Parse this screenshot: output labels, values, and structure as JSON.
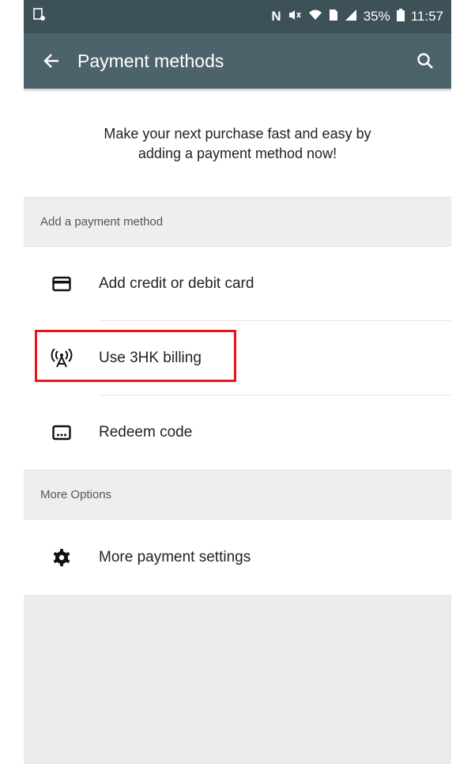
{
  "status_bar": {
    "notification_icon": "screenshot-icon",
    "nfc_label": "N",
    "battery_percent": "35%",
    "time": "11:57"
  },
  "app_bar": {
    "title": "Payment methods",
    "back_icon": "arrow-back-icon",
    "search_icon": "search-icon",
    "color": "#4d636b"
  },
  "intro": {
    "line1": "Make your next purchase fast and easy by",
    "line2": "adding a payment method now!"
  },
  "add_section": {
    "header": "Add a payment method",
    "items": [
      {
        "label": "Add credit or debit card",
        "icon": "credit-card-icon"
      },
      {
        "label": "Use 3HK billing",
        "icon": "carrier-billing-icon",
        "highlighted": true
      },
      {
        "label": "Redeem code",
        "icon": "redeem-code-icon"
      }
    ]
  },
  "more_section": {
    "header": "More Options",
    "items": [
      {
        "label": "More payment settings",
        "icon": "gear-icon"
      }
    ]
  },
  "colors": {
    "status_bar": "#3d5158",
    "highlight_border": "#e8141c",
    "background": "#ebebeb"
  }
}
